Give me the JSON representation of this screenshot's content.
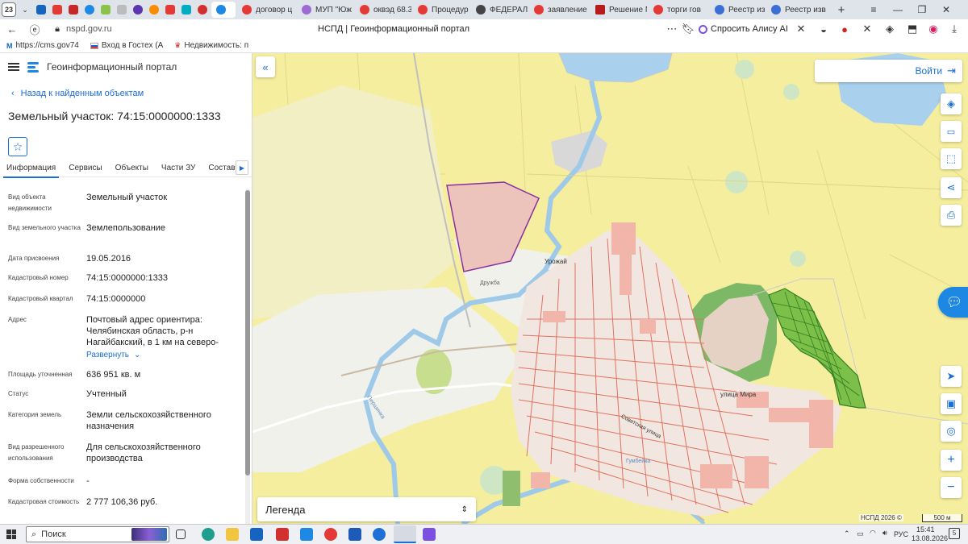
{
  "browser": {
    "tab_count": "23",
    "tabs": [
      {
        "label": "договор ц",
        "color": "#e53935"
      },
      {
        "label": "МУП \"Юж",
        "color": "#9c6bd6"
      },
      {
        "label": "оквэд 68.3",
        "color": "#e53935"
      },
      {
        "label": "Процедур",
        "color": "#e53935"
      },
      {
        "label": "ФЕДЕРАЛ",
        "color": "#444444"
      },
      {
        "label": "заявление",
        "color": "#e53935"
      },
      {
        "label": "Решение N",
        "color": "#b71c1c"
      },
      {
        "label": "торги гов",
        "color": "#e53935"
      },
      {
        "label": "Реестр изв",
        "color": "#3b6fd6"
      },
      {
        "label": "Реестр изв",
        "color": "#3b6fd6"
      }
    ],
    "url": "nspd.gov.ru",
    "page_title": "НСПД | Геоинформационный портал",
    "alice_label": "Спросить Алису AI",
    "bookmarks": [
      "https://cms.gov74",
      "Вход в Гостех (А",
      "Недвижимость: п"
    ]
  },
  "panel": {
    "app_title": "Геоинформационный портал",
    "back_link": "Назад к найденным объектам",
    "object_title": "Земельный участок: 74:15:0000000:1333",
    "tabs": [
      "Информация",
      "Сервисы",
      "Объекты",
      "Части ЗУ",
      "Состав"
    ],
    "expand_label": "Развернуть",
    "rows": {
      "kind": {
        "label": "Вид объекта недвижимости",
        "value": "Земельный участок"
      },
      "land_kind": {
        "label": "Вид земельного участка",
        "value": "Землепользование"
      },
      "assign_date": {
        "label": "Дата присвоения",
        "value": "19.05.2016"
      },
      "cad_number": {
        "label": "Кадастровый номер",
        "value": "74:15:0000000:1333"
      },
      "cad_quarter": {
        "label": "Кадастровый квартал",
        "value": "74:15:0000000"
      },
      "address": {
        "label": "Адрес",
        "value": "Почтовый адрес ориентира: Челябинская область, р-н Нагайбакский, в 1 км на северо-"
      },
      "area": {
        "label": "Площадь уточненная",
        "value": "636 951 кв. м"
      },
      "status": {
        "label": "Статус",
        "value": "Учтенный"
      },
      "category": {
        "label": "Категория земель",
        "value": "Земли сельскохозяйственного назначения"
      },
      "usage": {
        "label": "Вид разрешенного использования",
        "value": "Для сельскохозяйственного производства"
      },
      "ownership": {
        "label": "Форма собственности",
        "value": "-"
      },
      "cost": {
        "label": "Кадастровая стоимость",
        "value": "2 777 106,36 руб."
      }
    }
  },
  "map": {
    "login_label": "Войти",
    "legend_label": "Легенда",
    "copyright": "НСПД 2026 ©",
    "scale": "500 м",
    "labels": {
      "urozhai": "Урожай",
      "druzhba": "Дружба",
      "mira": "улица Мира",
      "sovetskaya": "Советская улица",
      "gumbeyka": "Гумбейка",
      "pershina": "Першинка"
    }
  },
  "taskbar": {
    "search_label": "Поиск",
    "lang": "РУС",
    "time": "15:41",
    "date": "13.08.2026",
    "notifications": "5"
  }
}
